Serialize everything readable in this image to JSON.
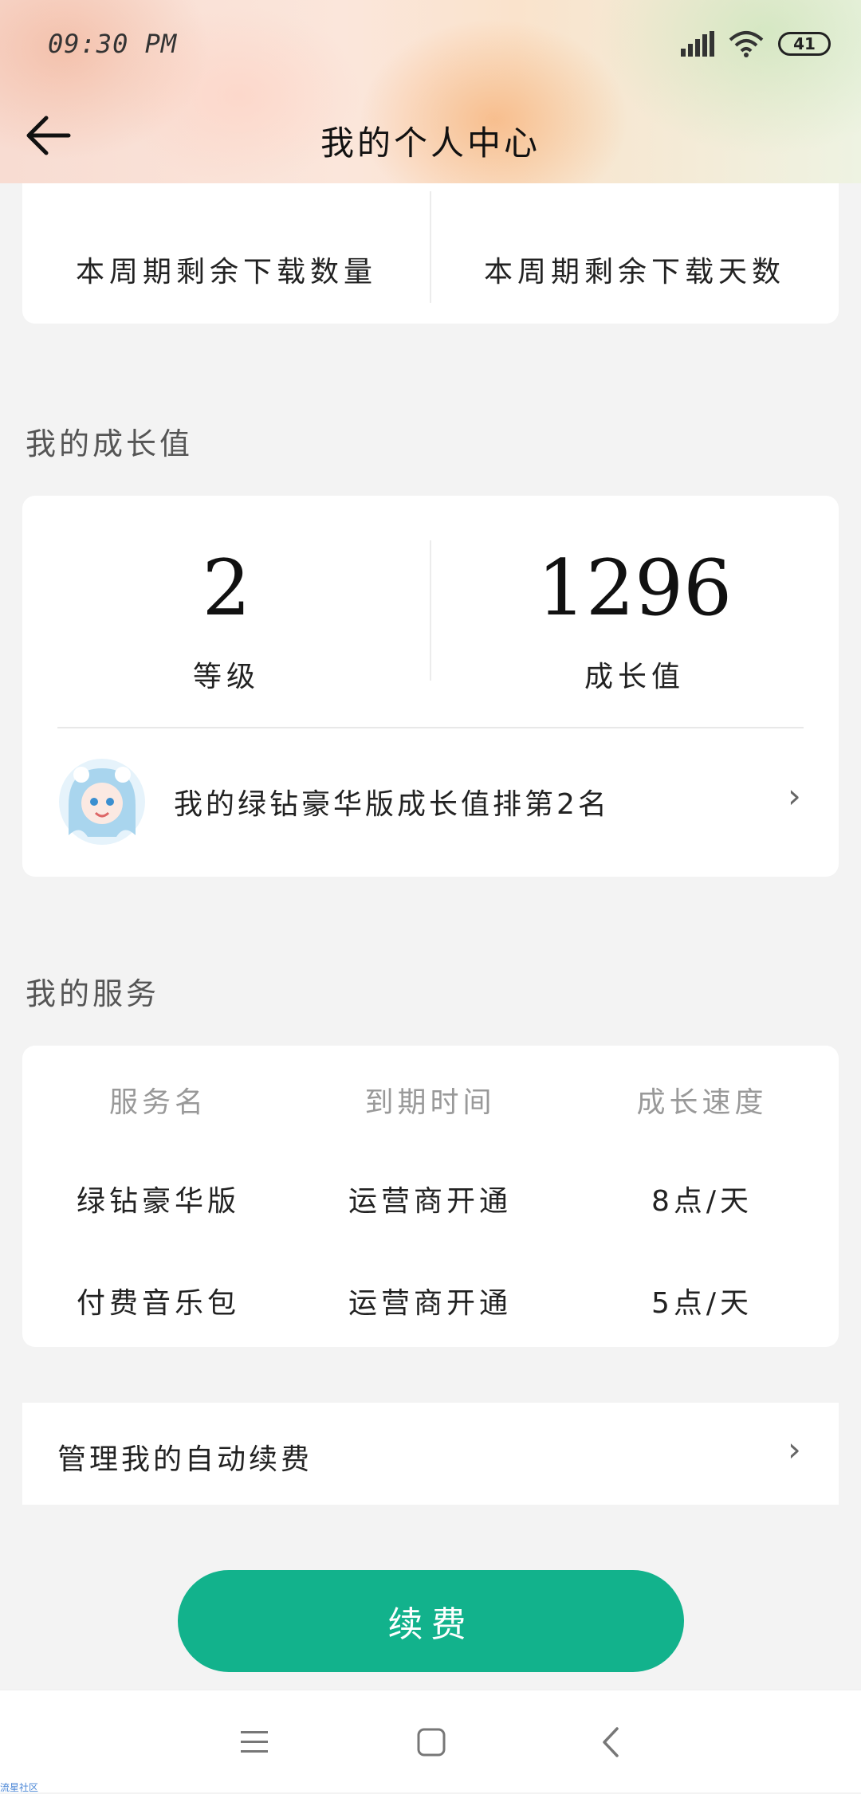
{
  "status_bar": {
    "time": "09:30 PM",
    "battery": "41"
  },
  "header": {
    "title": "我的个人中心"
  },
  "download_stats": {
    "remaining_count_label": "本周期剩余下载数量",
    "remaining_days_label": "本周期剩余下载天数"
  },
  "growth": {
    "section_title": "我的成长值",
    "level_value": "2",
    "level_label": "等级",
    "growth_value": "1296",
    "growth_label": "成长值",
    "ranking_text": "我的绿钻豪华版成长值排第2名"
  },
  "services": {
    "section_title": "我的服务",
    "columns": [
      "服务名",
      "到期时间",
      "成长速度"
    ],
    "rows": [
      [
        "绿钻豪华版",
        "运营商开通",
        "8点/天"
      ],
      [
        "付费音乐包",
        "运营商开通",
        "5点/天"
      ]
    ]
  },
  "auto_renew": {
    "label": "管理我的自动续费"
  },
  "renew_button": {
    "label": "续费"
  },
  "footer": {
    "corner_text": "流星社区"
  },
  "colors": {
    "accent": "#12b28c",
    "background": "#f3f3f3"
  }
}
